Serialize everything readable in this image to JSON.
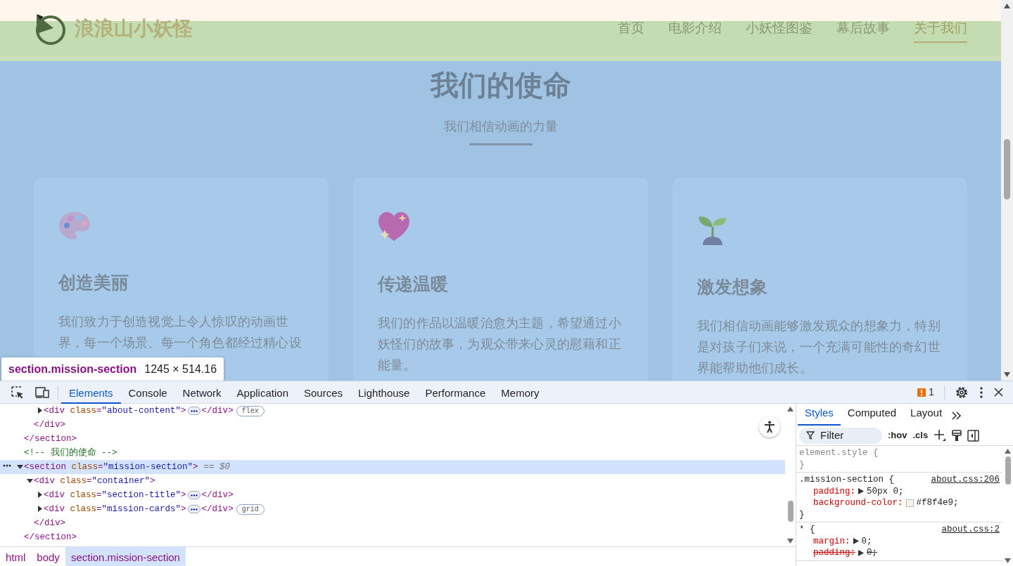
{
  "page": {
    "logo_text": "浪浪山小妖怪",
    "nav": [
      {
        "label": "首页",
        "selected": false
      },
      {
        "label": "电影介绍",
        "selected": false
      },
      {
        "label": "小妖怪图鉴",
        "selected": false
      },
      {
        "label": "幕后故事",
        "selected": false
      },
      {
        "label": "关于我们",
        "selected": true
      }
    ],
    "mission": {
      "title": "我们的使命",
      "subtitle": "我们相信动画的力量",
      "cards": [
        {
          "kind": "palette",
          "title": "创造美丽",
          "description": "我们致力于创造视觉上令人惊叹的动画世界，每一个场景、每一个角色都经过精心设"
        },
        {
          "kind": "heart",
          "title": "传递温暖",
          "description": "我们的作品以温暖治愈为主题，希望通过小妖怪们的故事，为观众带来心灵的慰藉和正能量。"
        },
        {
          "kind": "sprout",
          "title": "激发想象",
          "description": "我们相信动画能够激发观众的想象力，特别是对孩子们来说，一个充满可能性的奇幻世界能帮助他们成长。"
        }
      ]
    },
    "inspect_tooltip": {
      "selector": "section.mission-section",
      "size": "1245 × 514.16"
    }
  },
  "devtools": {
    "tabs": [
      {
        "label": "Elements",
        "selected": true
      },
      {
        "label": "Console",
        "selected": false
      },
      {
        "label": "Network",
        "selected": false
      },
      {
        "label": "Application",
        "selected": false
      },
      {
        "label": "Sources",
        "selected": false
      },
      {
        "label": "Lighthouse",
        "selected": false
      },
      {
        "label": "Performance",
        "selected": false
      },
      {
        "label": "Memory",
        "selected": false
      }
    ],
    "issues_count": "1",
    "dom_tree": [
      {
        "kind": "partial",
        "close": "</section>",
        "children": [
          {
            "kind": "partial",
            "close": "</div>",
            "children": [
              {
                "kind": "element",
                "open": "<div class=\"about-content\">",
                "close": "</div>",
                "expanded": false,
                "selected": false,
                "badge": "flex"
              }
            ]
          }
        ]
      },
      {
        "kind": "comment",
        "text": "<!-- 我们的使命 -->"
      },
      {
        "kind": "element",
        "open": "<section class=\"mission-section\">",
        "close": "</section>",
        "expanded": true,
        "selected": true,
        "marker": "== $0",
        "children": [
          {
            "kind": "element",
            "open": "<div class=\"container\">",
            "close": "</div>",
            "expanded": true,
            "selected": false,
            "children": [
              {
                "kind": "element",
                "open": "<div class=\"section-title\">",
                "close": "</div>",
                "expanded": false,
                "selected": false
              },
              {
                "kind": "element",
                "open": "<div class=\"mission-cards\">",
                "close": "</div>",
                "expanded": false,
                "selected": false,
                "badge": "grid"
              }
            ]
          }
        ]
      }
    ],
    "breadcrumbs": [
      {
        "label": "html",
        "selected": false
      },
      {
        "label": "body",
        "selected": false
      },
      {
        "label": "section.mission-section",
        "selected": true
      }
    ],
    "styles_tabs": [
      {
        "label": "Styles",
        "selected": true
      },
      {
        "label": "Computed",
        "selected": false
      },
      {
        "label": "Layout",
        "selected": false
      }
    ],
    "filter": {
      "placeholder": "Filter"
    },
    "hov": ":hov",
    "cls": ".cls",
    "rules": [
      {
        "selector": "element.style {",
        "end": "}"
      },
      {
        "selector": ".mission-section {",
        "source": "about.css:206",
        "end": "}",
        "props": [
          {
            "kind": "plain",
            "name": "padding:",
            "value": "50px 0;",
            "expandable": true,
            "overridden": false
          },
          {
            "kind": "color",
            "name": "background-color:",
            "value": "#f8f4e9;",
            "expandable": false,
            "overridden": false
          }
        ]
      },
      {
        "selector": "* {",
        "source": "about.css:2",
        "props": [
          {
            "kind": "plain",
            "name": "margin:",
            "value": "0;",
            "expandable": true,
            "overridden": false
          },
          {
            "kind": "plain",
            "name": "padding:",
            "value": "0;",
            "expandable": true,
            "overridden": true
          }
        ]
      }
    ]
  }
}
